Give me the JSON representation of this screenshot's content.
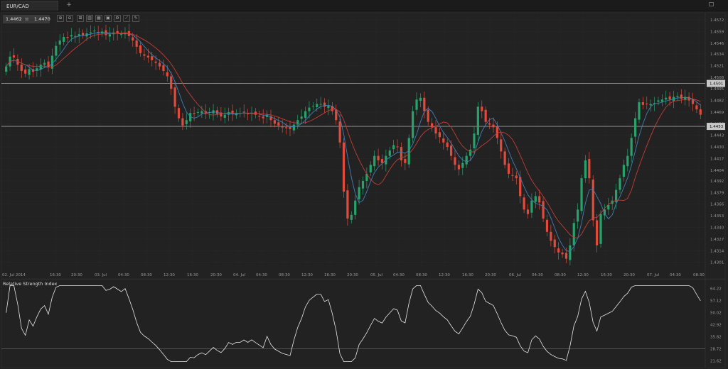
{
  "window": {
    "tab_title": "EUR/CAD",
    "add_tab": "+"
  },
  "quote": {
    "bid": "1.4462",
    "separator": "⊠",
    "ask": "1.4470"
  },
  "toolbar": [
    {
      "name": "zoom-in-icon",
      "glyph": "⊕"
    },
    {
      "name": "zoom-out-icon",
      "glyph": "⊖"
    },
    {
      "name": "crosshair-icon",
      "glyph": "⊞"
    },
    {
      "name": "candle-type-icon",
      "glyph": "▥"
    },
    {
      "name": "indicator-icon",
      "glyph": "▦"
    },
    {
      "name": "template-icon",
      "glyph": "▣"
    },
    {
      "name": "settings-icon",
      "glyph": "⚙"
    },
    {
      "name": "draw-icon",
      "glyph": "⟋"
    },
    {
      "name": "pen-icon",
      "glyph": "✎"
    }
  ],
  "colors": {
    "up": "#27a26b",
    "down": "#e24b3b",
    "ma_fast": "#3f7fb8",
    "ma_slow": "#c33d37",
    "rsi_line": "#e6e6e6",
    "rsi_level": "#c0392b",
    "hline": "#9a9a9a",
    "grid": "#2c2c2c",
    "bg": "#232323"
  },
  "chart_data": [
    {
      "type": "candlestick",
      "title": "EUR/CAD",
      "y_ticks": [
        "1.4572",
        "1.4559",
        "1.4546",
        "1.4534",
        "1.4521",
        "1.4508",
        "1.4495",
        "1.4482",
        "1.4469",
        "1.4456",
        "1.4443",
        "1.4430",
        "1.4417",
        "1.4404",
        "1.4392",
        "1.4379",
        "1.4366",
        "1.4353",
        "1.4340",
        "1.4327",
        "1.4314",
        "1.4301"
      ],
      "ylim": [
        1.4292,
        1.458
      ],
      "x_labels": [
        "02. Jul 2014",
        "16:30",
        "20:30",
        "03. Jul",
        "04:30",
        "08:30",
        "12:30",
        "16:30",
        "20:30",
        "04. Jul",
        "04:30",
        "08:30",
        "12:30",
        "16:30",
        "20:30",
        "05. Jul",
        "04:30",
        "08:30",
        "12:30",
        "16:30",
        "20:30",
        "06. Jul",
        "04:30",
        "08:30",
        "12:30",
        "16:30",
        "20:30",
        "07. Jul",
        "04:30",
        "08:30"
      ],
      "horizontal_lines": [
        {
          "value": 1.4501,
          "label": "1.4501"
        },
        {
          "value": 1.4453,
          "label": "1.4453"
        }
      ],
      "closes": [
        1.452,
        1.4531,
        1.453,
        1.4522,
        1.4515,
        1.4512,
        1.4517,
        1.4514,
        1.4518,
        1.4522,
        1.4524,
        1.4519,
        1.4532,
        1.4543,
        1.4549,
        1.4553,
        1.4552,
        1.4555,
        1.4554,
        1.4556,
        1.4555,
        1.4557,
        1.4558,
        1.456,
        1.4557,
        1.4559,
        1.4555,
        1.4556,
        1.4558,
        1.4557,
        1.4556,
        1.4558,
        1.4554,
        1.4549,
        1.4542,
        1.4535,
        1.4532,
        1.453,
        1.4527,
        1.4524,
        1.452,
        1.4515,
        1.4509,
        1.4495,
        1.4475,
        1.4462,
        1.4454,
        1.446,
        1.4468,
        1.4467,
        1.4469,
        1.447,
        1.4467,
        1.4469,
        1.4471,
        1.4467,
        1.4464,
        1.4466,
        1.4469,
        1.4467,
        1.4468,
        1.4468,
        1.4469,
        1.4467,
        1.4468,
        1.4466,
        1.4464,
        1.4462,
        1.4466,
        1.446,
        1.4456,
        1.4454,
        1.4452,
        1.4451,
        1.445,
        1.4455,
        1.446,
        1.4464,
        1.447,
        1.4474,
        1.4476,
        1.4478,
        1.4478,
        1.4475,
        1.4476,
        1.447,
        1.446,
        1.4435,
        1.438,
        1.435,
        1.4354,
        1.437,
        1.4385,
        1.4392,
        1.44,
        1.441,
        1.442,
        1.4415,
        1.4412,
        1.442,
        1.4426,
        1.4432,
        1.443,
        1.4415,
        1.4412,
        1.444,
        1.447,
        1.4483,
        1.4485,
        1.447,
        1.4458,
        1.4452,
        1.4445,
        1.4441,
        1.4435,
        1.443,
        1.442,
        1.441,
        1.4405,
        1.4412,
        1.442,
        1.4427,
        1.4445,
        1.4475,
        1.447,
        1.4458,
        1.4455,
        1.4452,
        1.444,
        1.4425,
        1.441,
        1.44,
        1.4398,
        1.4395,
        1.4375,
        1.436,
        1.4355,
        1.437,
        1.4375,
        1.4368,
        1.435,
        1.4335,
        1.4325,
        1.4318,
        1.4312,
        1.431,
        1.4305,
        1.432,
        1.4345,
        1.436,
        1.4395,
        1.4415,
        1.4395,
        1.4348,
        1.432,
        1.4355,
        1.436,
        1.4365,
        1.437,
        1.4382,
        1.4395,
        1.441,
        1.442,
        1.444,
        1.4462,
        1.448,
        1.4477,
        1.4478,
        1.4478,
        1.4479,
        1.4482,
        1.4483,
        1.4485,
        1.4483,
        1.4486,
        1.4487,
        1.4484,
        1.4486,
        1.4482,
        1.4478,
        1.4472,
        1.4466
      ]
    },
    {
      "type": "line",
      "title": "Relative Strength Index",
      "y_ticks": [
        "64.22",
        "57.12",
        "50.02",
        "42.92",
        "35.82",
        "28.72",
        "21.62"
      ],
      "ylim": [
        20.2,
        67.0
      ],
      "level": 28.72
    }
  ]
}
